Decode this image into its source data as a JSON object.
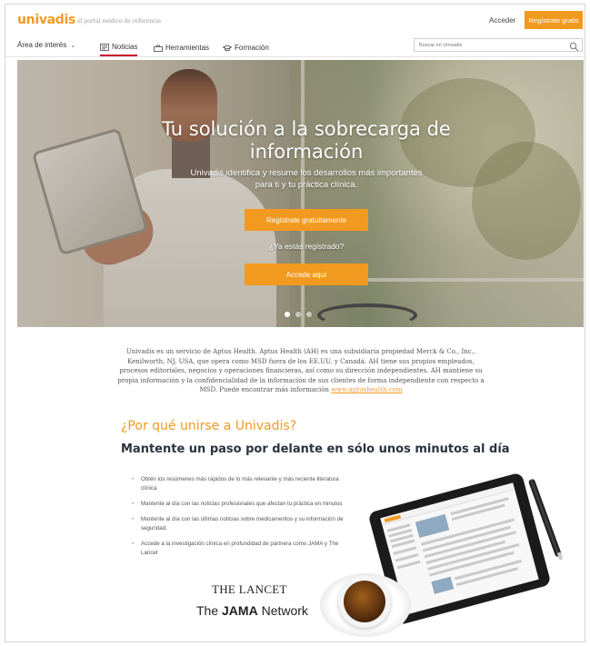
{
  "header": {
    "logo": "univadis",
    "tagline": "el portal médico de referencia",
    "login_label": "Acceder",
    "register_label": "Regístrate gratis"
  },
  "nav": {
    "area_label": "Área de interés",
    "items": [
      {
        "label": "Noticias",
        "icon": "newspaper-icon",
        "active": true
      },
      {
        "label": "Herramientas",
        "icon": "toolbox-icon",
        "active": false
      },
      {
        "label": "Formación",
        "icon": "graduation-cap-icon",
        "active": false
      }
    ],
    "search_placeholder": "Buscar en Univadis"
  },
  "hero": {
    "title": "Tu solución a la sobrecarga de información",
    "subtitle": "Univadis identifica y resume los desarrollos más importantes para ti y tu práctica clínica.",
    "register_cta": "Regístrate gratuitamente",
    "already_registered": "¿Ya estás registrado?",
    "login_cta": "Accede aquí",
    "slide_count": 3,
    "active_slide": 1
  },
  "disclaimer": {
    "text": "Univadis es un servicio de Aptus Health. Aptus Health (AH) es una subsidiaria propiedad Merck & Co., Inc., Kenilworth, NJ, USA, que opera como MSD fuera de los EE.UU. y Canadá. AH tiene sus propios empleados, procesos editoriales, negocios y operaciones financieras, así como su dirección independientes. AH mantiene su propia información y la confidencialidad de la información de sus clientes de forma independiente con respecto a MSD. Puede encontrar más información",
    "link_text": "www.aptushealth.com"
  },
  "why": {
    "title": "¿Por qué unirse a Univadis?",
    "subtitle": "Mantente un paso por delante en sólo unos minutos al día",
    "benefits": [
      "Obtén los resúmenes más rápidos de lo más relevante y más reciente literatura clínica",
      "Mantente al día con las noticias profesionales que afectan tu práctica en minutos",
      "Mantente al día con las últimas noticias sobre medicamentos y su información de seguridad.",
      "Accede a la investigación clínica en profundidad de partnera como JAMA y The Lancet"
    ]
  },
  "partners": {
    "lancet": "THE LANCET",
    "jama_prefix": "The ",
    "jama_bold": "JAMA",
    "jama_suffix": " Network"
  },
  "colors": {
    "accent": "#f29a1f",
    "nav_active": "#c8102e",
    "heading_dark": "#2a3340"
  }
}
